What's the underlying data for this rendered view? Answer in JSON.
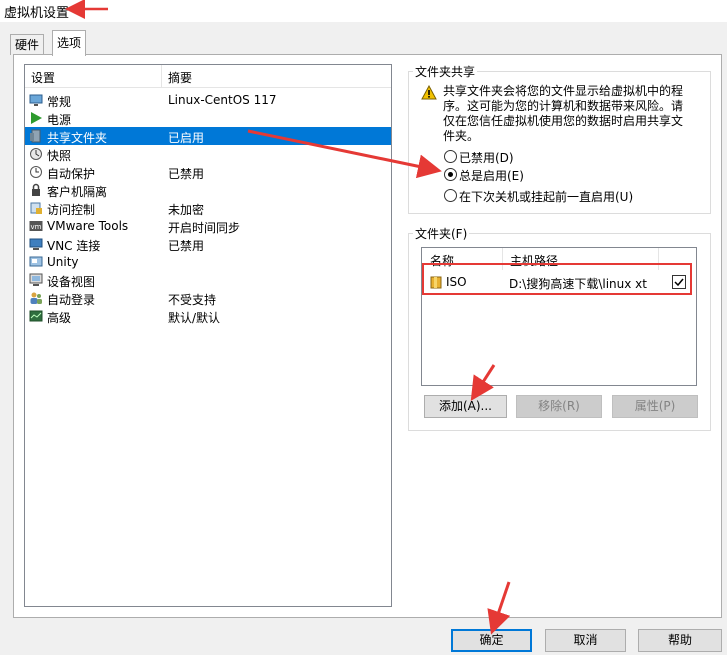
{
  "window": {
    "title": "虚拟机设置"
  },
  "tabs": [
    {
      "label": "硬件"
    },
    {
      "label": "选项"
    }
  ],
  "settings_list": {
    "headers": {
      "setting": "设置",
      "summary": "摘要"
    },
    "items": [
      {
        "name": "常规",
        "summary": "Linux-CentOS 117",
        "icon": "monitor-icon"
      },
      {
        "name": "电源",
        "summary": "",
        "icon": "power-play-icon"
      },
      {
        "name": "共享文件夹",
        "summary": "已启用",
        "icon": "shared-folder-icon",
        "selected": true
      },
      {
        "name": "快照",
        "summary": "",
        "icon": "snapshot-icon"
      },
      {
        "name": "自动保护",
        "summary": "已禁用",
        "icon": "clock-icon"
      },
      {
        "name": "客户机隔离",
        "summary": "",
        "icon": "isolation-icon"
      },
      {
        "name": "访问控制",
        "summary": "未加密",
        "icon": "lock-icon"
      },
      {
        "name": "VMware Tools",
        "summary": "开启时间同步",
        "icon": "vmware-icon"
      },
      {
        "name": "VNC 连接",
        "summary": "已禁用",
        "icon": "vnc-icon"
      },
      {
        "name": "Unity",
        "summary": "",
        "icon": "unity-icon"
      },
      {
        "name": "设备视图",
        "summary": "",
        "icon": "device-view-icon"
      },
      {
        "name": "自动登录",
        "summary": "不受支持",
        "icon": "users-icon"
      },
      {
        "name": "高级",
        "summary": "默认/默认",
        "icon": "advanced-icon"
      }
    ]
  },
  "folder_sharing": {
    "title": "文件夹共享",
    "warning": "共享文件夹会将您的文件显示给虚拟机中的程序。这可能为您的计算机和数据带来风险。请仅在您信任虚拟机使用您的数据时启用共享文件夹。",
    "options": [
      {
        "label": "已禁用(D)",
        "selected": false
      },
      {
        "label": "总是启用(E)",
        "selected": true
      },
      {
        "label": "在下次关机或挂起前一直启用(U)",
        "selected": false
      }
    ]
  },
  "folders": {
    "title": "文件夹(F)",
    "headers": {
      "name": "名称",
      "host_path": "主机路径"
    },
    "rows": [
      {
        "name": "ISO",
        "host_path": "D:\\搜狗高速下载\\linux xt",
        "checked": true
      }
    ],
    "buttons": {
      "add": "添加(A)...",
      "remove": "移除(R)",
      "properties": "属性(P)"
    }
  },
  "footer": {
    "ok": "确定",
    "cancel": "取消",
    "help": "帮助"
  },
  "colors": {
    "selection": "#0078d7",
    "annotation": "#e53935",
    "warning": "#f2c200"
  }
}
